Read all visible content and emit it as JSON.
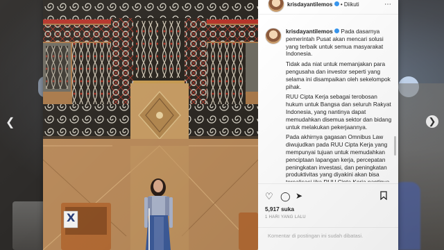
{
  "post": {
    "header_username": "krisdayantilemos",
    "header_separator": "•",
    "header_follow": "Diikuti",
    "more_icon": "more-options-icon",
    "caption_username": "krisdayantilemos",
    "caption_paragraphs": [
      "Pada dasarnya pemerintah Pusat akan mencari solusi yang terbaik untuk semua masyarakat Indonesia.",
      "Tidak ada niat untuk memanjakan para pengusaha dan investor seperti yang selama ini disampaikan oleh sekelompok pihak.",
      "RUU Cipta Kerja sebagai terobosan hukum untuk Bangsa dan seluruh Rakyat Indonesia, yang nantinya dapat memudahkan disemua sektor dan bidang untuk melakukan pekerjaannya.",
      "Pada akhirnya gagasan Omnibus Law diwujudkan pada RUU Cipta Kerja yang mempunyai tujuan untuk memudahkan penciptaan lapangan kerja, percepatan peningkatan investasi, dan peningkatan produktivitas yang diyakini akan bisa terealisasi jika RUU Cipta Kerja nantinya"
    ],
    "likes": "5,917 suka",
    "time_ago": "1 HARI YANG LALU",
    "comment_placeholder": "Komentar di postingan ini sudah dibatasi.",
    "photo_sign_letter": "X"
  },
  "icons": {
    "like": "heart-icon",
    "comment": "comment-icon",
    "share": "share-icon",
    "save": "bookmark-icon",
    "prev": "chevron-left-icon",
    "next": "chevron-right-icon"
  },
  "colors": {
    "verified": "#3897f0",
    "text": "#262626",
    "muted": "#8e8e8e"
  }
}
